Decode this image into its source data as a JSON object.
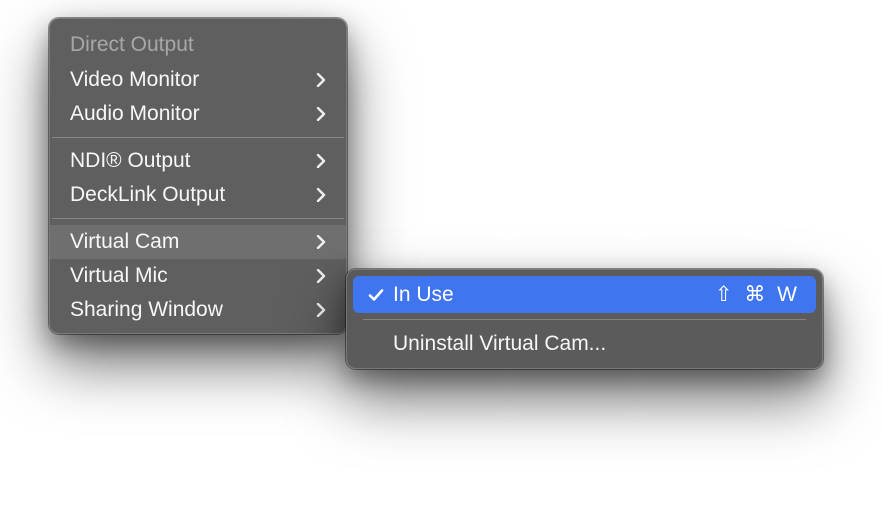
{
  "menu": {
    "header": "Direct Output",
    "items": [
      {
        "label": "Video Monitor",
        "hasSubmenu": true
      },
      {
        "label": "Audio Monitor",
        "hasSubmenu": true
      },
      {
        "separator": true
      },
      {
        "label": "NDI® Output",
        "hasSubmenu": true
      },
      {
        "label": "DeckLink Output",
        "hasSubmenu": true
      },
      {
        "separator": true
      },
      {
        "label": "Virtual Cam",
        "hasSubmenu": true,
        "highlighted": true
      },
      {
        "label": "Virtual Mic",
        "hasSubmenu": true
      },
      {
        "label": "Sharing Window",
        "hasSubmenu": true
      }
    ]
  },
  "submenu": {
    "items": [
      {
        "label": "In Use",
        "checked": true,
        "selected": true,
        "shortcut": "⇧ ⌘ W"
      },
      {
        "separator": true
      },
      {
        "label": "Uninstall Virtual Cam..."
      }
    ]
  }
}
